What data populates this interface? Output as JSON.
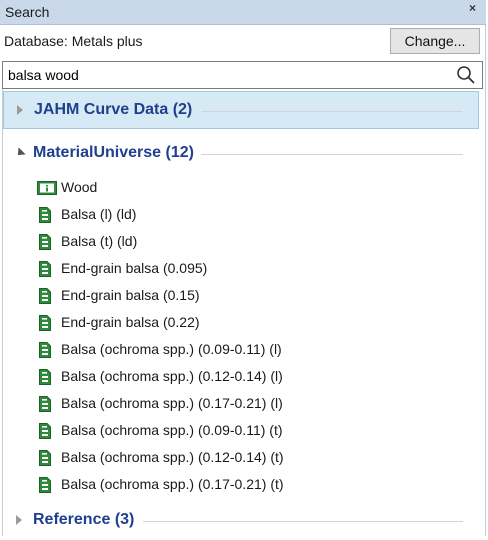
{
  "panel": {
    "title": "Search",
    "close_glyph": "×",
    "database_label": "Database: Metals plus",
    "change_button": "Change...",
    "search_value": "balsa wood",
    "search_icon": "search-icon"
  },
  "groups": [
    {
      "label": "JAHM Curve Data (2)",
      "expanded": false,
      "selected": true
    },
    {
      "label": "MaterialUniverse (12)",
      "expanded": true,
      "selected": false
    },
    {
      "label": "Reference (3)",
      "expanded": false,
      "selected": false
    }
  ],
  "folder_item": {
    "label": "Wood",
    "icon": "folder-info-icon"
  },
  "items": [
    {
      "label": "Balsa (l) (ld)"
    },
    {
      "label": "Balsa (t) (ld)"
    },
    {
      "label": "End-grain balsa (0.095)"
    },
    {
      "label": "End-grain balsa (0.15)"
    },
    {
      "label": "End-grain balsa (0.22)"
    },
    {
      "label": "Balsa (ochroma spp.) (0.09-0.11) (l)"
    },
    {
      "label": "Balsa (ochroma spp.) (0.12-0.14) (l)"
    },
    {
      "label": "Balsa (ochroma spp.) (0.17-0.21) (l)"
    },
    {
      "label": "Balsa (ochroma spp.) (0.09-0.11) (t)"
    },
    {
      "label": "Balsa (ochroma spp.) (0.12-0.14) (t)"
    },
    {
      "label": "Balsa (ochroma spp.) (0.17-0.21) (t)"
    }
  ],
  "colors": {
    "accent": "#1f3f8f",
    "icon_green": "#2e8b3a",
    "titlebar": "#c9d9ea"
  }
}
